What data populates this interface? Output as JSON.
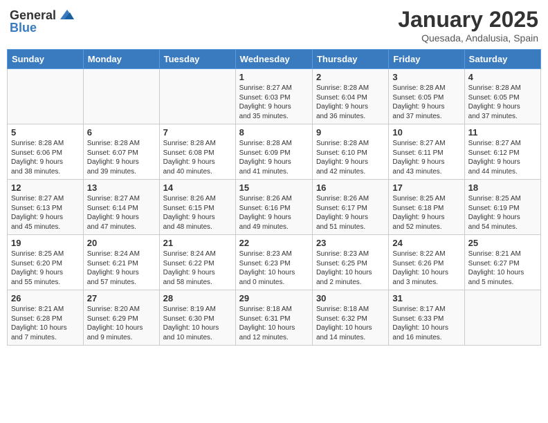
{
  "header": {
    "logo_general": "General",
    "logo_blue": "Blue",
    "month": "January 2025",
    "location": "Quesada, Andalusia, Spain"
  },
  "calendar": {
    "days_of_week": [
      "Sunday",
      "Monday",
      "Tuesday",
      "Wednesday",
      "Thursday",
      "Friday",
      "Saturday"
    ],
    "weeks": [
      [
        {
          "day": "",
          "info": ""
        },
        {
          "day": "",
          "info": ""
        },
        {
          "day": "",
          "info": ""
        },
        {
          "day": "1",
          "info": "Sunrise: 8:27 AM\nSunset: 6:03 PM\nDaylight: 9 hours\nand 35 minutes."
        },
        {
          "day": "2",
          "info": "Sunrise: 8:28 AM\nSunset: 6:04 PM\nDaylight: 9 hours\nand 36 minutes."
        },
        {
          "day": "3",
          "info": "Sunrise: 8:28 AM\nSunset: 6:05 PM\nDaylight: 9 hours\nand 37 minutes."
        },
        {
          "day": "4",
          "info": "Sunrise: 8:28 AM\nSunset: 6:05 PM\nDaylight: 9 hours\nand 37 minutes."
        }
      ],
      [
        {
          "day": "5",
          "info": "Sunrise: 8:28 AM\nSunset: 6:06 PM\nDaylight: 9 hours\nand 38 minutes."
        },
        {
          "day": "6",
          "info": "Sunrise: 8:28 AM\nSunset: 6:07 PM\nDaylight: 9 hours\nand 39 minutes."
        },
        {
          "day": "7",
          "info": "Sunrise: 8:28 AM\nSunset: 6:08 PM\nDaylight: 9 hours\nand 40 minutes."
        },
        {
          "day": "8",
          "info": "Sunrise: 8:28 AM\nSunset: 6:09 PM\nDaylight: 9 hours\nand 41 minutes."
        },
        {
          "day": "9",
          "info": "Sunrise: 8:28 AM\nSunset: 6:10 PM\nDaylight: 9 hours\nand 42 minutes."
        },
        {
          "day": "10",
          "info": "Sunrise: 8:27 AM\nSunset: 6:11 PM\nDaylight: 9 hours\nand 43 minutes."
        },
        {
          "day": "11",
          "info": "Sunrise: 8:27 AM\nSunset: 6:12 PM\nDaylight: 9 hours\nand 44 minutes."
        }
      ],
      [
        {
          "day": "12",
          "info": "Sunrise: 8:27 AM\nSunset: 6:13 PM\nDaylight: 9 hours\nand 45 minutes."
        },
        {
          "day": "13",
          "info": "Sunrise: 8:27 AM\nSunset: 6:14 PM\nDaylight: 9 hours\nand 47 minutes."
        },
        {
          "day": "14",
          "info": "Sunrise: 8:26 AM\nSunset: 6:15 PM\nDaylight: 9 hours\nand 48 minutes."
        },
        {
          "day": "15",
          "info": "Sunrise: 8:26 AM\nSunset: 6:16 PM\nDaylight: 9 hours\nand 49 minutes."
        },
        {
          "day": "16",
          "info": "Sunrise: 8:26 AM\nSunset: 6:17 PM\nDaylight: 9 hours\nand 51 minutes."
        },
        {
          "day": "17",
          "info": "Sunrise: 8:25 AM\nSunset: 6:18 PM\nDaylight: 9 hours\nand 52 minutes."
        },
        {
          "day": "18",
          "info": "Sunrise: 8:25 AM\nSunset: 6:19 PM\nDaylight: 9 hours\nand 54 minutes."
        }
      ],
      [
        {
          "day": "19",
          "info": "Sunrise: 8:25 AM\nSunset: 6:20 PM\nDaylight: 9 hours\nand 55 minutes."
        },
        {
          "day": "20",
          "info": "Sunrise: 8:24 AM\nSunset: 6:21 PM\nDaylight: 9 hours\nand 57 minutes."
        },
        {
          "day": "21",
          "info": "Sunrise: 8:24 AM\nSunset: 6:22 PM\nDaylight: 9 hours\nand 58 minutes."
        },
        {
          "day": "22",
          "info": "Sunrise: 8:23 AM\nSunset: 6:23 PM\nDaylight: 10 hours\nand 0 minutes."
        },
        {
          "day": "23",
          "info": "Sunrise: 8:23 AM\nSunset: 6:25 PM\nDaylight: 10 hours\nand 2 minutes."
        },
        {
          "day": "24",
          "info": "Sunrise: 8:22 AM\nSunset: 6:26 PM\nDaylight: 10 hours\nand 3 minutes."
        },
        {
          "day": "25",
          "info": "Sunrise: 8:21 AM\nSunset: 6:27 PM\nDaylight: 10 hours\nand 5 minutes."
        }
      ],
      [
        {
          "day": "26",
          "info": "Sunrise: 8:21 AM\nSunset: 6:28 PM\nDaylight: 10 hours\nand 7 minutes."
        },
        {
          "day": "27",
          "info": "Sunrise: 8:20 AM\nSunset: 6:29 PM\nDaylight: 10 hours\nand 9 minutes."
        },
        {
          "day": "28",
          "info": "Sunrise: 8:19 AM\nSunset: 6:30 PM\nDaylight: 10 hours\nand 10 minutes."
        },
        {
          "day": "29",
          "info": "Sunrise: 8:18 AM\nSunset: 6:31 PM\nDaylight: 10 hours\nand 12 minutes."
        },
        {
          "day": "30",
          "info": "Sunrise: 8:18 AM\nSunset: 6:32 PM\nDaylight: 10 hours\nand 14 minutes."
        },
        {
          "day": "31",
          "info": "Sunrise: 8:17 AM\nSunset: 6:33 PM\nDaylight: 10 hours\nand 16 minutes."
        },
        {
          "day": "",
          "info": ""
        }
      ]
    ]
  }
}
